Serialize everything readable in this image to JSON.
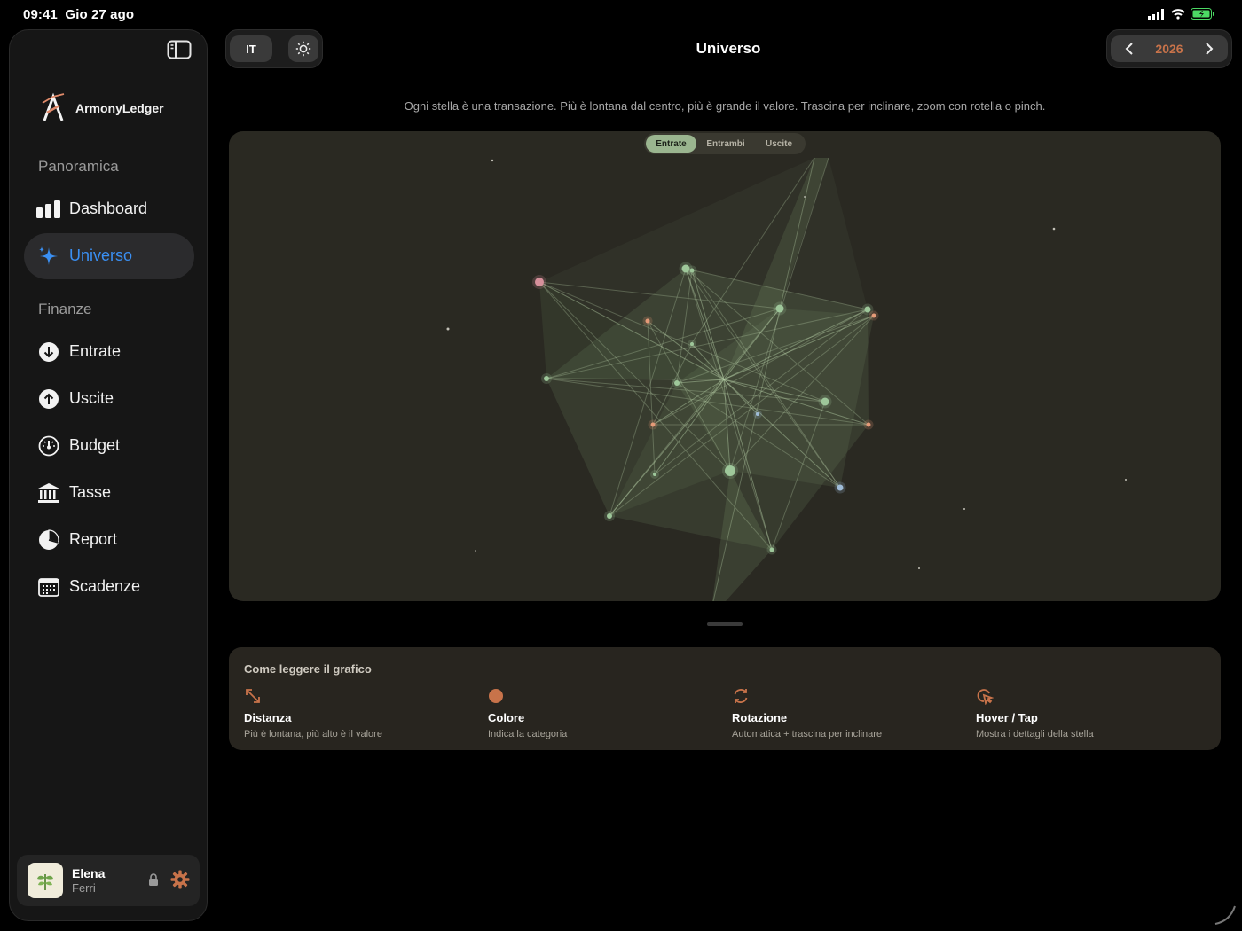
{
  "status": {
    "time": "09:41",
    "date": "Gio 27 ago"
  },
  "sidebar": {
    "brand": "ArmonyLedger",
    "sections": [
      "Panoramica",
      "Finanze"
    ],
    "items": [
      {
        "label": "Dashboard",
        "icon": "bar-chart-icon"
      },
      {
        "label": "Universo",
        "icon": "sparkles-icon",
        "active": true
      },
      {
        "label": "Entrate",
        "icon": "arrow-down-circle-icon"
      },
      {
        "label": "Uscite",
        "icon": "arrow-up-circle-icon"
      },
      {
        "label": "Budget",
        "icon": "gauge-icon"
      },
      {
        "label": "Tasse",
        "icon": "bank-icon"
      },
      {
        "label": "Report",
        "icon": "pie-chart-icon"
      },
      {
        "label": "Scadenze",
        "icon": "calendar-icon"
      }
    ],
    "user": {
      "first": "Elena",
      "last": "Ferri"
    }
  },
  "toolbar": {
    "lang": "IT",
    "title": "Universo",
    "year": "2026"
  },
  "main": {
    "description": "Ogni stella è una transazione. Più è lontana dal centro, più è grande il valore. Trascina per inclinare, zoom con rotella o pinch.",
    "filter": {
      "options": [
        "Entrate",
        "Entrambi",
        "Uscite"
      ],
      "selected": "Entrate"
    }
  },
  "legend": {
    "title": "Come leggere il grafico",
    "items": [
      {
        "title": "Distanza",
        "sub": "Più è lontana, più alto è il valore",
        "icon": "arrows-expand-icon"
      },
      {
        "title": "Colore",
        "sub": "Indica la categoria",
        "icon": "color-dot-icon"
      },
      {
        "title": "Rotazione",
        "sub": "Automatica + trascina per inclinare",
        "icon": "rotate-icon"
      },
      {
        "title": "Hover / Tap",
        "sub": "Mostra i dettagli della stella",
        "icon": "tap-icon"
      }
    ]
  },
  "colors": {
    "accent": "#3a8ff2",
    "orange": "#c8734a",
    "green": "#9ab58f",
    "sidebar": "#161616"
  }
}
